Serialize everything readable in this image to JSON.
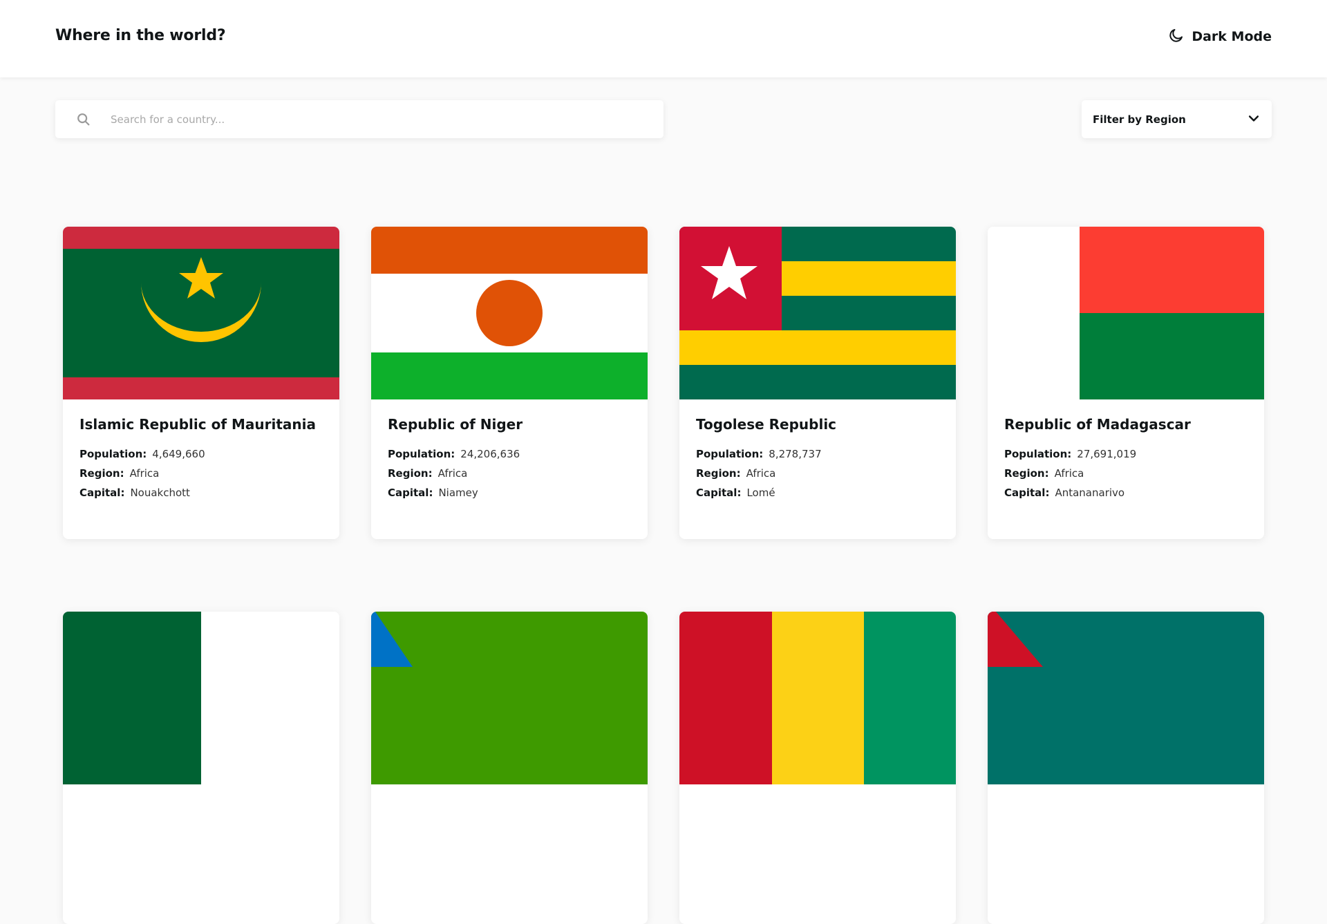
{
  "header": {
    "title": "Where in the world?",
    "mode_label": "Dark Mode"
  },
  "search": {
    "placeholder": "Search for a country..."
  },
  "filter": {
    "label": "Filter by Region"
  },
  "labels": {
    "population": "Population:",
    "region": "Region:",
    "capital": "Capital:"
  },
  "countries": [
    {
      "name": "Islamic Republic of Mauritania",
      "population": "4,649,660",
      "region": "Africa",
      "capital": "Nouakchott"
    },
    {
      "name": "Republic of Niger",
      "population": "24,206,636",
      "region": "Africa",
      "capital": "Niamey"
    },
    {
      "name": "Togolese Republic",
      "population": "8,278,737",
      "region": "Africa",
      "capital": "Lomé"
    },
    {
      "name": "Republic of Madagascar",
      "population": "27,691,019",
      "region": "Africa",
      "capital": "Antananarivo"
    }
  ],
  "icons": {
    "theme": "moon-icon",
    "search": "search-icon",
    "dropdown": "chevron-down-icon"
  },
  "colors": {
    "background": "#fafafa",
    "card": "#ffffff",
    "text": "#111517"
  }
}
